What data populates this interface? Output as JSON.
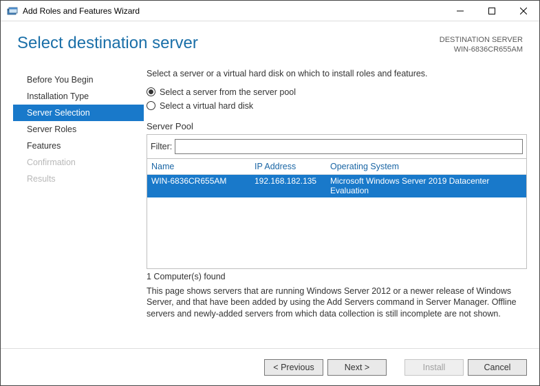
{
  "window": {
    "title": "Add Roles and Features Wizard"
  },
  "header": {
    "pageTitle": "Select destination server",
    "destLabel": "DESTINATION SERVER",
    "destServer": "WIN-6836CR655AM"
  },
  "sidebar": {
    "items": [
      {
        "label": "Before You Begin",
        "state": "normal"
      },
      {
        "label": "Installation Type",
        "state": "normal"
      },
      {
        "label": "Server Selection",
        "state": "active"
      },
      {
        "label": "Server Roles",
        "state": "normal"
      },
      {
        "label": "Features",
        "state": "normal"
      },
      {
        "label": "Confirmation",
        "state": "disabled"
      },
      {
        "label": "Results",
        "state": "disabled"
      }
    ]
  },
  "main": {
    "intro": "Select a server or a virtual hard disk on which to install roles and features.",
    "radios": {
      "pool": "Select a server from the server pool",
      "vhd": "Select a virtual hard disk",
      "selected": "pool"
    },
    "poolLabel": "Server Pool",
    "filterLabel": "Filter:",
    "filterValue": "",
    "columns": {
      "name": "Name",
      "ip": "IP Address",
      "os": "Operating System"
    },
    "rows": [
      {
        "name": "WIN-6836CR655AM",
        "ip": "192.168.182.135",
        "os": "Microsoft Windows Server 2019 Datacenter Evaluation"
      }
    ],
    "foundLabel": "1 Computer(s) found",
    "description": "This page shows servers that are running Windows Server 2012 or a newer release of Windows Server, and that have been added by using the Add Servers command in Server Manager. Offline servers and newly-added servers from which data collection is still incomplete are not shown."
  },
  "footer": {
    "previous": "< Previous",
    "next": "Next >",
    "install": "Install",
    "cancel": "Cancel"
  }
}
